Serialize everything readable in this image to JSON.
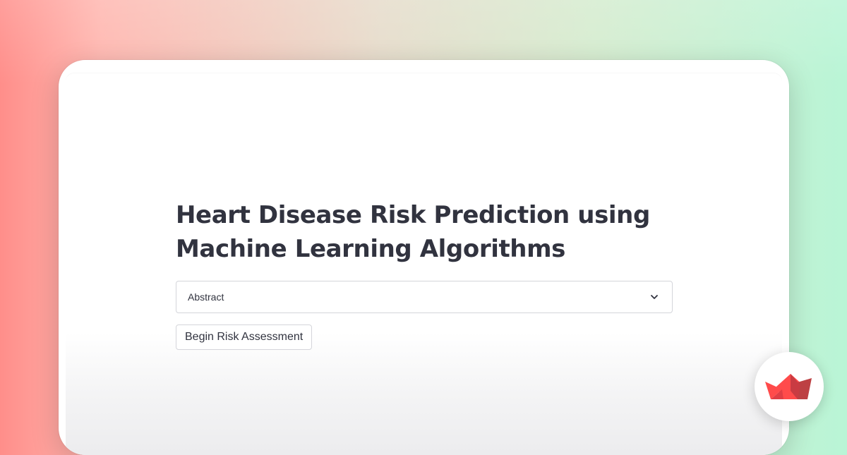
{
  "app": {
    "title": "Heart Disease Risk Prediction using Machine Learning Algorithms"
  },
  "selectbox": {
    "selected": "Abstract",
    "icon": "chevron-down-icon"
  },
  "actions": {
    "begin_label": "Begin Risk Assessment"
  },
  "brand": {
    "logo": "streamlit-logo",
    "colors": {
      "logo_red": "#ff4b4b",
      "logo_dark": "#bd4043",
      "text": "#31333f"
    }
  }
}
